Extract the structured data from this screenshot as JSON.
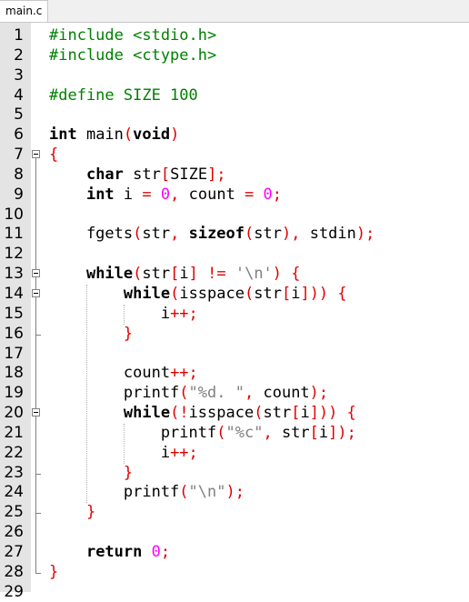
{
  "tab": {
    "label": "main.c"
  },
  "lines": [
    {
      "n": "1",
      "fold": "none",
      "tokens": [
        [
          "pp",
          "#include <stdio.h>"
        ]
      ]
    },
    {
      "n": "2",
      "fold": "none",
      "tokens": [
        [
          "pp",
          "#include <ctype.h>"
        ]
      ]
    },
    {
      "n": "3",
      "fold": "none",
      "tokens": []
    },
    {
      "n": "4",
      "fold": "none",
      "tokens": [
        [
          "pp",
          "#define SIZE 100"
        ]
      ]
    },
    {
      "n": "5",
      "fold": "none",
      "tokens": []
    },
    {
      "n": "6",
      "fold": "none",
      "tokens": [
        [
          "kw",
          "int"
        ],
        [
          "t",
          " main"
        ],
        [
          "op",
          "("
        ],
        [
          "kw",
          "void"
        ],
        [
          "op",
          ")"
        ]
      ]
    },
    {
      "n": "7",
      "fold": "start",
      "tokens": [
        [
          "op",
          "{"
        ]
      ]
    },
    {
      "n": "8",
      "fold": "mid",
      "tokens": [
        [
          "t",
          "    "
        ],
        [
          "kw",
          "char"
        ],
        [
          "t",
          " str"
        ],
        [
          "op",
          "["
        ],
        [
          "t",
          "SIZE"
        ],
        [
          "op",
          "];"
        ]
      ]
    },
    {
      "n": "9",
      "fold": "mid",
      "tokens": [
        [
          "t",
          "    "
        ],
        [
          "kw",
          "int"
        ],
        [
          "t",
          " i "
        ],
        [
          "op",
          "="
        ],
        [
          "t",
          " "
        ],
        [
          "num",
          "0"
        ],
        [
          "op",
          ","
        ],
        [
          "t",
          " count "
        ],
        [
          "op",
          "="
        ],
        [
          "t",
          " "
        ],
        [
          "num",
          "0"
        ],
        [
          "op",
          ";"
        ]
      ]
    },
    {
      "n": "10",
      "fold": "mid",
      "tokens": []
    },
    {
      "n": "11",
      "fold": "mid",
      "tokens": [
        [
          "t",
          "    fgets"
        ],
        [
          "op",
          "("
        ],
        [
          "t",
          "str"
        ],
        [
          "op",
          ","
        ],
        [
          "t",
          " "
        ],
        [
          "kw",
          "sizeof"
        ],
        [
          "op",
          "("
        ],
        [
          "t",
          "str"
        ],
        [
          "op",
          "),"
        ],
        [
          "t",
          " stdin"
        ],
        [
          "op",
          ");"
        ]
      ]
    },
    {
      "n": "12",
      "fold": "mid",
      "tokens": []
    },
    {
      "n": "13",
      "fold": "start",
      "tokens": [
        [
          "t",
          "    "
        ],
        [
          "kw",
          "while"
        ],
        [
          "op",
          "("
        ],
        [
          "t",
          "str"
        ],
        [
          "op",
          "["
        ],
        [
          "t",
          "i"
        ],
        [
          "op",
          "]"
        ],
        [
          "t",
          " "
        ],
        [
          "op",
          "!="
        ],
        [
          "t",
          " "
        ],
        [
          "str",
          "'\\n'"
        ],
        [
          "op",
          ")"
        ],
        [
          "t",
          " "
        ],
        [
          "op",
          "{"
        ]
      ]
    },
    {
      "n": "14",
      "fold": "start",
      "tokens": [
        [
          "t",
          "        "
        ],
        [
          "kw",
          "while"
        ],
        [
          "op",
          "("
        ],
        [
          "t",
          "isspace"
        ],
        [
          "op",
          "("
        ],
        [
          "t",
          "str"
        ],
        [
          "op",
          "["
        ],
        [
          "t",
          "i"
        ],
        [
          "op",
          "]))"
        ],
        [
          "t",
          " "
        ],
        [
          "op",
          "{"
        ]
      ]
    },
    {
      "n": "15",
      "fold": "mid",
      "tokens": [
        [
          "t",
          "            i"
        ],
        [
          "op",
          "++;"
        ]
      ]
    },
    {
      "n": "16",
      "fold": "end",
      "tokens": [
        [
          "t",
          "        "
        ],
        [
          "op",
          "}"
        ]
      ]
    },
    {
      "n": "17",
      "fold": "mid",
      "tokens": []
    },
    {
      "n": "18",
      "fold": "mid",
      "tokens": [
        [
          "t",
          "        count"
        ],
        [
          "op",
          "++;"
        ]
      ]
    },
    {
      "n": "19",
      "fold": "mid",
      "tokens": [
        [
          "t",
          "        printf"
        ],
        [
          "op",
          "("
        ],
        [
          "str",
          "\""
        ],
        [
          "esc",
          "%d"
        ],
        [
          "str",
          ". \""
        ],
        [
          "op",
          ","
        ],
        [
          "t",
          " count"
        ],
        [
          "op",
          ");"
        ]
      ]
    },
    {
      "n": "20",
      "fold": "start",
      "tokens": [
        [
          "t",
          "        "
        ],
        [
          "kw",
          "while"
        ],
        [
          "op",
          "(!"
        ],
        [
          "t",
          "isspace"
        ],
        [
          "op",
          "("
        ],
        [
          "t",
          "str"
        ],
        [
          "op",
          "["
        ],
        [
          "t",
          "i"
        ],
        [
          "op",
          "]))"
        ],
        [
          "t",
          " "
        ],
        [
          "op",
          "{"
        ]
      ]
    },
    {
      "n": "21",
      "fold": "mid",
      "tokens": [
        [
          "t",
          "            printf"
        ],
        [
          "op",
          "("
        ],
        [
          "str",
          "\""
        ],
        [
          "esc",
          "%c"
        ],
        [
          "str",
          "\""
        ],
        [
          "op",
          ","
        ],
        [
          "t",
          " str"
        ],
        [
          "op",
          "["
        ],
        [
          "t",
          "i"
        ],
        [
          "op",
          "]);"
        ]
      ]
    },
    {
      "n": "22",
      "fold": "mid",
      "tokens": [
        [
          "t",
          "            i"
        ],
        [
          "op",
          "++;"
        ]
      ]
    },
    {
      "n": "23",
      "fold": "end",
      "tokens": [
        [
          "t",
          "        "
        ],
        [
          "op",
          "}"
        ]
      ]
    },
    {
      "n": "24",
      "fold": "mid",
      "tokens": [
        [
          "t",
          "        printf"
        ],
        [
          "op",
          "("
        ],
        [
          "str",
          "\""
        ],
        [
          "esc",
          "\\n"
        ],
        [
          "str",
          "\""
        ],
        [
          "op",
          ");"
        ]
      ]
    },
    {
      "n": "25",
      "fold": "end",
      "tokens": [
        [
          "t",
          "    "
        ],
        [
          "op",
          "}"
        ]
      ]
    },
    {
      "n": "26",
      "fold": "mid",
      "tokens": []
    },
    {
      "n": "27",
      "fold": "mid",
      "tokens": [
        [
          "t",
          "    "
        ],
        [
          "kw",
          "return"
        ],
        [
          "t",
          " "
        ],
        [
          "num",
          "0"
        ],
        [
          "op",
          ";"
        ]
      ]
    },
    {
      "n": "28",
      "fold": "end",
      "tokens": [
        [
          "op",
          "}"
        ]
      ]
    },
    {
      "n": "29",
      "fold": "none",
      "tokens": []
    }
  ]
}
